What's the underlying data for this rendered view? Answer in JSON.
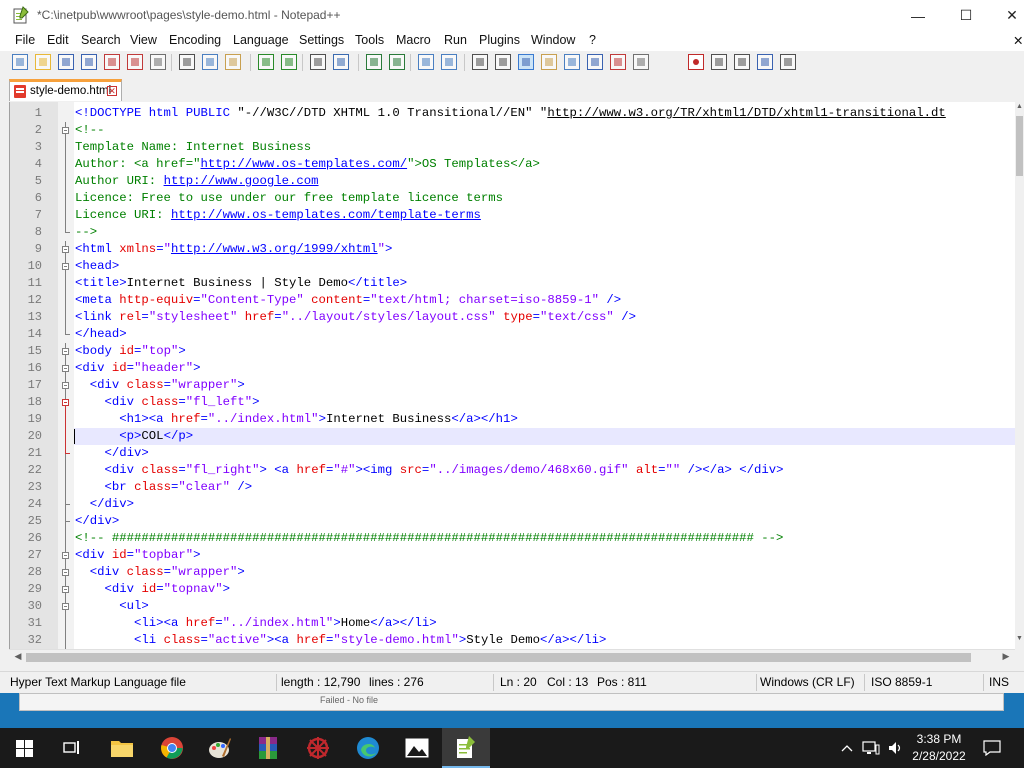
{
  "window": {
    "title": "*C:\\inetpub\\wwwroot\\pages\\style-demo.html - Notepad++",
    "minimize_glyph": "—",
    "maximize_glyph": "☐",
    "close_glyph": "✕"
  },
  "menu": [
    "File",
    "Edit",
    "Search",
    "View",
    "Encoding",
    "Language",
    "Settings",
    "Tools",
    "Macro",
    "Run",
    "Plugins",
    "Window",
    "?"
  ],
  "menu_close_glyph": "✕",
  "toolbar_icons": [
    "new-file-icon",
    "open-file-icon",
    "save-icon",
    "save-all-icon",
    "close-icon",
    "close-all-icon",
    "print-icon",
    "cut-icon",
    "copy-icon",
    "paste-icon",
    "undo-icon",
    "redo-icon",
    "find-icon",
    "replace-icon",
    "zoom-in-icon",
    "zoom-out-icon",
    "sync-vertical-icon",
    "sync-horizontal-icon",
    "word-wrap-icon",
    "show-all-chars-icon",
    "indent-guide-icon",
    "udl-icon",
    "doc-map-icon",
    "function-list-icon",
    "folder-workspace-icon",
    "monitoring-icon",
    "record-macro-icon",
    "stop-macro-icon",
    "play-macro-icon",
    "run-macro-multiple-icon",
    "save-macro-icon"
  ],
  "tab": {
    "label": "style-demo.html",
    "close_glyph": "✕"
  },
  "editor": {
    "current_line": 20,
    "lines": [
      {
        "n": "1",
        "fold": "",
        "tokens": [
          [
            "tag",
            "<!DOCTYPE html PUBLIC "
          ],
          [
            "text",
            "\"-//W3C//DTD XHTML 1.0 Transitional//EN\" "
          ],
          [
            "text",
            "\""
          ],
          [
            "curl",
            "http://www.w3.org/TR/xhtml1/DTD/xhtml1-transitional.dt"
          ]
        ]
      },
      {
        "n": "2",
        "fold": "box",
        "tokens": [
          [
            "com",
            "<!--"
          ]
        ]
      },
      {
        "n": "3",
        "fold": "line",
        "tokens": [
          [
            "com",
            "Template Name: Internet Business"
          ]
        ]
      },
      {
        "n": "4",
        "fold": "line",
        "tokens": [
          [
            "com",
            "Author: <a href=\""
          ],
          [
            "url",
            "http://www.os-templates.com/"
          ],
          [
            "com",
            "\">OS Templates</a>"
          ]
        ]
      },
      {
        "n": "5",
        "fold": "line",
        "tokens": [
          [
            "com",
            "Author URI: "
          ],
          [
            "url",
            "http://www.google.com"
          ]
        ]
      },
      {
        "n": "6",
        "fold": "line",
        "tokens": [
          [
            "com",
            "Licence: Free to use under our free template licence terms"
          ]
        ]
      },
      {
        "n": "7",
        "fold": "line",
        "tokens": [
          [
            "com",
            "Licence URI: "
          ],
          [
            "url",
            "http://www.os-templates.com/template-terms"
          ]
        ]
      },
      {
        "n": "8",
        "fold": "end",
        "tokens": [
          [
            "com",
            "-->"
          ]
        ]
      },
      {
        "n": "9",
        "fold": "box",
        "tokens": [
          [
            "tag",
            "<html "
          ],
          [
            "attr",
            "xmlns"
          ],
          [
            "tag",
            "="
          ],
          [
            "str",
            "\""
          ],
          [
            "url",
            "http://www.w3.org/1999/xhtml"
          ],
          [
            "str",
            "\""
          ],
          [
            "tag",
            ">"
          ]
        ]
      },
      {
        "n": "10",
        "fold": "box",
        "tokens": [
          [
            "tag",
            "<head>"
          ]
        ]
      },
      {
        "n": "11",
        "fold": "line",
        "tokens": [
          [
            "tag",
            "<title>"
          ],
          [
            "text",
            "Internet Business | Style Demo"
          ],
          [
            "tag",
            "</title>"
          ]
        ]
      },
      {
        "n": "12",
        "fold": "line",
        "tokens": [
          [
            "tag",
            "<meta "
          ],
          [
            "attr",
            "http-equiv"
          ],
          [
            "tag",
            "="
          ],
          [
            "str",
            "\"Content-Type\""
          ],
          [
            "tag",
            " "
          ],
          [
            "attr",
            "content"
          ],
          [
            "tag",
            "="
          ],
          [
            "str",
            "\"text/html; charset=iso-8859-1\""
          ],
          [
            "tag",
            " />"
          ]
        ]
      },
      {
        "n": "13",
        "fold": "line",
        "tokens": [
          [
            "tag",
            "<link "
          ],
          [
            "attr",
            "rel"
          ],
          [
            "tag",
            "="
          ],
          [
            "str",
            "\"stylesheet\""
          ],
          [
            "tag",
            " "
          ],
          [
            "attr",
            "href"
          ],
          [
            "tag",
            "="
          ],
          [
            "str",
            "\"../layout/styles/layout.css\""
          ],
          [
            "tag",
            " "
          ],
          [
            "attr",
            "type"
          ],
          [
            "tag",
            "="
          ],
          [
            "str",
            "\"text/css\""
          ],
          [
            "tag",
            " />"
          ]
        ]
      },
      {
        "n": "14",
        "fold": "end",
        "tokens": [
          [
            "tag",
            "</head>"
          ]
        ]
      },
      {
        "n": "15",
        "fold": "box",
        "tokens": [
          [
            "tag",
            "<body "
          ],
          [
            "attr",
            "id"
          ],
          [
            "tag",
            "="
          ],
          [
            "str",
            "\"top\""
          ],
          [
            "tag",
            ">"
          ]
        ]
      },
      {
        "n": "16",
        "fold": "box",
        "tokens": [
          [
            "tag",
            "<div "
          ],
          [
            "attr",
            "id"
          ],
          [
            "tag",
            "="
          ],
          [
            "str",
            "\"header\""
          ],
          [
            "tag",
            ">"
          ]
        ]
      },
      {
        "n": "17",
        "fold": "box",
        "tokens": [
          [
            "text",
            "  "
          ],
          [
            "tag",
            "<div "
          ],
          [
            "attr",
            "class"
          ],
          [
            "tag",
            "="
          ],
          [
            "str",
            "\"wrapper\""
          ],
          [
            "tag",
            ">"
          ]
        ]
      },
      {
        "n": "18",
        "fold": "boxred",
        "tokens": [
          [
            "text",
            "    "
          ],
          [
            "tag",
            "<div "
          ],
          [
            "attr",
            "class"
          ],
          [
            "tag",
            "="
          ],
          [
            "str",
            "\"fl_left\""
          ],
          [
            "tag",
            ">"
          ]
        ]
      },
      {
        "n": "19",
        "fold": "linered",
        "tokens": [
          [
            "text",
            "      "
          ],
          [
            "tag",
            "<h1><a "
          ],
          [
            "attr",
            "href"
          ],
          [
            "tag",
            "="
          ],
          [
            "str",
            "\"../index.html\""
          ],
          [
            "tag",
            ">"
          ],
          [
            "text",
            "Internet Business"
          ],
          [
            "tag",
            "</a></h1>"
          ]
        ]
      },
      {
        "n": "20",
        "fold": "linered",
        "tokens": [
          [
            "text",
            "      "
          ],
          [
            "tag",
            "<p>"
          ],
          [
            "text",
            "COL"
          ],
          [
            "tag",
            "</p>"
          ]
        ]
      },
      {
        "n": "21",
        "fold": "endred",
        "tokens": [
          [
            "text",
            "    "
          ],
          [
            "tag",
            "</div>"
          ]
        ]
      },
      {
        "n": "22",
        "fold": "line",
        "tokens": [
          [
            "text",
            "    "
          ],
          [
            "tag",
            "<div "
          ],
          [
            "attr",
            "class"
          ],
          [
            "tag",
            "="
          ],
          [
            "str",
            "\"fl_right\""
          ],
          [
            "tag",
            "> <a "
          ],
          [
            "attr",
            "href"
          ],
          [
            "tag",
            "="
          ],
          [
            "str",
            "\"#\""
          ],
          [
            "tag",
            "><img "
          ],
          [
            "attr",
            "src"
          ],
          [
            "tag",
            "="
          ],
          [
            "str",
            "\"../images/demo/468x60.gif\""
          ],
          [
            "tag",
            " "
          ],
          [
            "attr",
            "alt"
          ],
          [
            "tag",
            "="
          ],
          [
            "str",
            "\"\""
          ],
          [
            "tag",
            " /></a> </div>"
          ]
        ]
      },
      {
        "n": "23",
        "fold": "line",
        "tokens": [
          [
            "text",
            "    "
          ],
          [
            "tag",
            "<br "
          ],
          [
            "attr",
            "class"
          ],
          [
            "tag",
            "="
          ],
          [
            "str",
            "\"clear\""
          ],
          [
            "tag",
            " />"
          ]
        ]
      },
      {
        "n": "24",
        "fold": "end",
        "tokens": [
          [
            "text",
            "  "
          ],
          [
            "tag",
            "</div>"
          ]
        ]
      },
      {
        "n": "25",
        "fold": "end",
        "tokens": [
          [
            "tag",
            "</div>"
          ]
        ]
      },
      {
        "n": "26",
        "fold": "line",
        "tokens": [
          [
            "com",
            "<!-- ####################################################################################### -->"
          ]
        ]
      },
      {
        "n": "27",
        "fold": "box",
        "tokens": [
          [
            "tag",
            "<div "
          ],
          [
            "attr",
            "id"
          ],
          [
            "tag",
            "="
          ],
          [
            "str",
            "\"topbar\""
          ],
          [
            "tag",
            ">"
          ]
        ]
      },
      {
        "n": "28",
        "fold": "box",
        "tokens": [
          [
            "text",
            "  "
          ],
          [
            "tag",
            "<div "
          ],
          [
            "attr",
            "class"
          ],
          [
            "tag",
            "="
          ],
          [
            "str",
            "\"wrapper\""
          ],
          [
            "tag",
            ">"
          ]
        ]
      },
      {
        "n": "29",
        "fold": "box",
        "tokens": [
          [
            "text",
            "    "
          ],
          [
            "tag",
            "<div "
          ],
          [
            "attr",
            "id"
          ],
          [
            "tag",
            "="
          ],
          [
            "str",
            "\"topnav\""
          ],
          [
            "tag",
            ">"
          ]
        ]
      },
      {
        "n": "30",
        "fold": "box",
        "tokens": [
          [
            "text",
            "      "
          ],
          [
            "tag",
            "<ul>"
          ]
        ]
      },
      {
        "n": "31",
        "fold": "line",
        "tokens": [
          [
            "text",
            "        "
          ],
          [
            "tag",
            "<li><a "
          ],
          [
            "attr",
            "href"
          ],
          [
            "tag",
            "="
          ],
          [
            "str",
            "\"../index.html\""
          ],
          [
            "tag",
            ">"
          ],
          [
            "text",
            "Home"
          ],
          [
            "tag",
            "</a></li>"
          ]
        ]
      },
      {
        "n": "32",
        "fold": "line",
        "tokens": [
          [
            "text",
            "        "
          ],
          [
            "tag",
            "<li "
          ],
          [
            "attr",
            "class"
          ],
          [
            "tag",
            "="
          ],
          [
            "str",
            "\"active\""
          ],
          [
            "tag",
            "><a "
          ],
          [
            "attr",
            "href"
          ],
          [
            "tag",
            "="
          ],
          [
            "str",
            "\"style-demo.html\""
          ],
          [
            "tag",
            ">"
          ],
          [
            "text",
            "Style Demo"
          ],
          [
            "tag",
            "</a></li>"
          ]
        ]
      }
    ]
  },
  "status": {
    "file_type": "Hyper Text Markup Language file",
    "length": "length : 12,790",
    "lines": "lines : 276",
    "ln": "Ln : 20",
    "col": "Col : 13",
    "pos": "Pos : 811",
    "eol": "Windows (CR LF)",
    "encoding": "ISO 8859-1",
    "mode": "INS"
  },
  "background_text": "Failed - No file",
  "taskbar": {
    "time": "3:38 PM",
    "date": "2/28/2022",
    "apps": [
      "task-view-icon",
      "file-explorer-icon",
      "chrome-icon",
      "paint-icon",
      "winrar-icon",
      "app-icon",
      "edge-icon",
      "photos-icon",
      "notepadpp-icon"
    ]
  },
  "colors": {
    "tab_accent": "#f7a13c",
    "tag": "#0000ff",
    "attr": "#e40000",
    "string": "#8000ff",
    "comment": "#008000",
    "current_line": "#e8e8ff"
  }
}
